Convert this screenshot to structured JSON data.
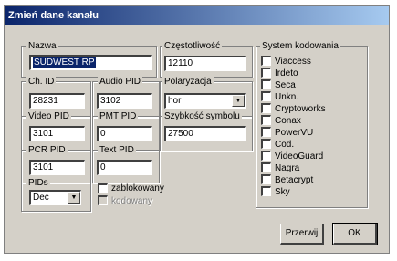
{
  "window": {
    "title": "Zmień dane kanału"
  },
  "fields": {
    "nazwa": {
      "label": "Nazwa",
      "value": "SUDWEST RP"
    },
    "czestotliwosc": {
      "label": "Częstotliwość",
      "value": "12110"
    },
    "ch_id": {
      "label": "Ch. ID",
      "value": "28231"
    },
    "audio_pid": {
      "label": "Audio PID",
      "value": "3102"
    },
    "polaryzacja": {
      "label": "Polaryzacja",
      "value": "hor"
    },
    "video_pid": {
      "label": "Video PID",
      "value": "3101"
    },
    "pmt_pid": {
      "label": "PMT PID",
      "value": "0"
    },
    "szybkosc": {
      "label": "Szybkość symbolu",
      "value": "27500"
    },
    "pcr_pid": {
      "label": "PCR PID",
      "value": "3101"
    },
    "text_pid": {
      "label": "Text PID",
      "value": "0"
    },
    "pids": {
      "label": "PIDs",
      "value": "Dec"
    }
  },
  "flags": {
    "zablokowany": "zablokowany",
    "kodowany": "kodowany"
  },
  "encoding": {
    "label": "System kodowania",
    "items": [
      "Viaccess",
      "Irdeto",
      "Seca",
      "Unkn.",
      "Cryptoworks",
      "Conax",
      "PowerVU",
      "Cod.",
      "VideoGuard",
      "Nagra",
      "Betacrypt",
      "Sky"
    ]
  },
  "buttons": {
    "cancel": "Przerwij",
    "ok": "OK"
  }
}
